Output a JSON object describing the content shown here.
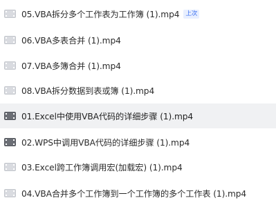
{
  "files": [
    {
      "name": "05.VBA拆分多个工作表为工作簿 (1).mp4",
      "badge": "上次",
      "icon": "video-file-icon",
      "highlighted": false
    },
    {
      "name": "06.VBA多表合并 (1).mp4",
      "icon": "video-file-icon",
      "highlighted": false
    },
    {
      "name": "07.VBA多簿合并 (1).mp4",
      "icon": "video-file-icon",
      "highlighted": false
    },
    {
      "name": "08.VBA拆分数据到表或簿 (1).mp4",
      "icon": "video-file-icon",
      "highlighted": false
    },
    {
      "name": "01.Excel中使用VBA代码的详细步骤 (1).mp4",
      "icon": "video-file-icon",
      "highlighted": true
    },
    {
      "name": "02.WPS中调用VBA代码的详细步骤 (1).mp4",
      "icon": "video-file-icon",
      "highlighted": false
    },
    {
      "name": "03.Excel跨工作簿调用宏(加载宏) (1).mp4",
      "icon": "video-file-icon",
      "highlighted": false
    },
    {
      "name": "04.VBA合并多个工作簿到一个工作簿的多个工作表 (1).mp4",
      "icon": "video-file-icon",
      "highlighted": false
    }
  ],
  "colors": {
    "highlight_bg": "#f0f1f3",
    "badge_text": "#3a6ff0",
    "badge_bg": "#e8efff"
  }
}
